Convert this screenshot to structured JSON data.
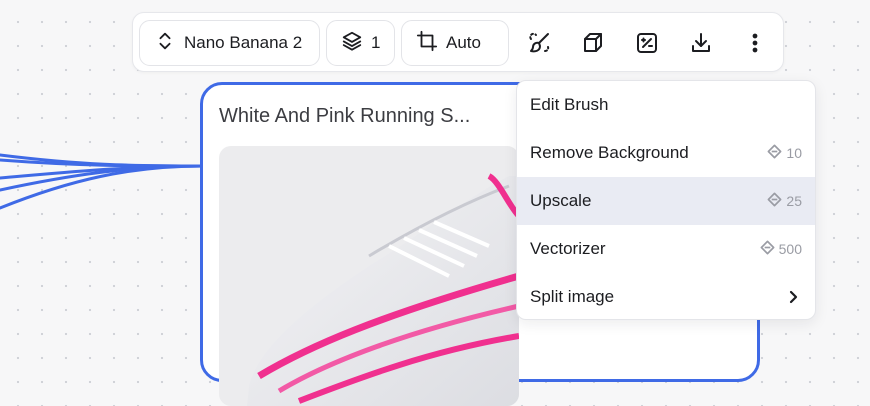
{
  "toolbar": {
    "model_label": "Nano Banana 2",
    "count_label": "1",
    "aspect_label": "Auto",
    "icons": [
      "chevron-updown-icon",
      "layers-icon",
      "crop-icon",
      "brush-icon",
      "cube-icon",
      "percent-square-icon",
      "download-icon",
      "more-vertical-icon"
    ]
  },
  "card": {
    "title": "White And Pink Running S...",
    "image_desc_icon": "shoe-image"
  },
  "menu": {
    "items": [
      {
        "label": "Edit Brush",
        "credits": ""
      },
      {
        "label": "Remove Background",
        "credits": "10"
      },
      {
        "label": "Upscale",
        "credits": "25"
      },
      {
        "label": "Vectorizer",
        "credits": "500"
      },
      {
        "label": "Split image",
        "credits": ""
      }
    ]
  },
  "colors": {
    "accent": "#3f6ae6",
    "menu_highlight": "#e9ebf3",
    "shoe_pink": "#f0308f"
  }
}
